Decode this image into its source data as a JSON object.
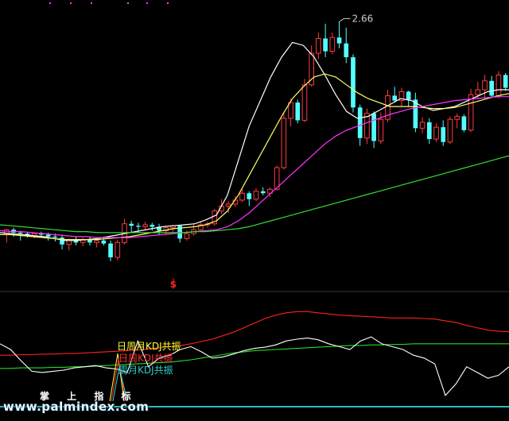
{
  "colors": {
    "background": "#000000",
    "candle_up": "#ff3c3c",
    "candle_down": "#54ffff",
    "ma_short": "#ffffff",
    "ma_mid": "#ffff66",
    "ma_long": "#ff33ff",
    "ma_xlong": "#33dd33",
    "line_red": "#ff2020",
    "line_green": "#20dd20",
    "line_white": "#ffffff",
    "label_yellow": "#ffff33",
    "label_red": "#ff3030",
    "label_cyan": "#33cccc",
    "baseline_cyan": "#20c0c0"
  },
  "chart_data": [
    {
      "type": "candlestick",
      "annotation_high": "2.66",
      "signal_marker": "S",
      "candles": [
        {
          "o": 20,
          "h": 26,
          "l": 12,
          "c": 25
        },
        {
          "o": 25,
          "h": 27,
          "l": 18,
          "c": 22
        },
        {
          "o": 22,
          "h": 24,
          "l": 14,
          "c": 21
        },
        {
          "o": 21,
          "h": 23,
          "l": 17,
          "c": 19
        },
        {
          "o": 19,
          "h": 22,
          "l": 16,
          "c": 21
        },
        {
          "o": 21,
          "h": 23,
          "l": 18,
          "c": 20
        },
        {
          "o": 20,
          "h": 22,
          "l": 14,
          "c": 18
        },
        {
          "o": 18,
          "h": 21,
          "l": 13,
          "c": 17
        },
        {
          "o": 17,
          "h": 20,
          "l": 5,
          "c": 10
        },
        {
          "o": 10,
          "h": 16,
          "l": 4,
          "c": 15
        },
        {
          "o": 15,
          "h": 18,
          "l": 9,
          "c": 12
        },
        {
          "o": 12,
          "h": 17,
          "l": 8,
          "c": 15
        },
        {
          "o": 15,
          "h": 18,
          "l": 9,
          "c": 12
        },
        {
          "o": 12,
          "h": 16,
          "l": 7,
          "c": 14
        },
        {
          "o": 14,
          "h": 18,
          "l": 9,
          "c": 11
        },
        {
          "o": 11,
          "h": 14,
          "l": -7,
          "c": -3
        },
        {
          "o": -3,
          "h": 15,
          "l": -6,
          "c": 12
        },
        {
          "o": 12,
          "h": 36,
          "l": 10,
          "c": 31
        },
        {
          "o": 31,
          "h": 34,
          "l": 22,
          "c": 29
        },
        {
          "o": 29,
          "h": 32,
          "l": 22,
          "c": 28
        },
        {
          "o": 28,
          "h": 33,
          "l": 24,
          "c": 30
        },
        {
          "o": 30,
          "h": 32,
          "l": 24,
          "c": 28
        },
        {
          "o": 28,
          "h": 31,
          "l": 20,
          "c": 24
        },
        {
          "o": 24,
          "h": 29,
          "l": 20,
          "c": 27
        },
        {
          "o": 27,
          "h": 30,
          "l": 23,
          "c": 29
        },
        {
          "o": 29,
          "h": 30,
          "l": 12,
          "c": 16
        },
        {
          "o": 16,
          "h": 24,
          "l": 14,
          "c": 21
        },
        {
          "o": 21,
          "h": 31,
          "l": 19,
          "c": 25
        },
        {
          "o": 25,
          "h": 33,
          "l": 24,
          "c": 30
        },
        {
          "o": 30,
          "h": 33,
          "l": 27,
          "c": 31
        },
        {
          "o": 31,
          "h": 46,
          "l": 29,
          "c": 44
        },
        {
          "o": 44,
          "h": 56,
          "l": 41,
          "c": 49
        },
        {
          "o": 49,
          "h": 54,
          "l": 42,
          "c": 51
        },
        {
          "o": 51,
          "h": 59,
          "l": 48,
          "c": 55
        },
        {
          "o": 55,
          "h": 66,
          "l": 53,
          "c": 62
        },
        {
          "o": 62,
          "h": 64,
          "l": 49,
          "c": 56
        },
        {
          "o": 56,
          "h": 67,
          "l": 54,
          "c": 64
        },
        {
          "o": 64,
          "h": 68,
          "l": 60,
          "c": 62
        },
        {
          "o": 62,
          "h": 68,
          "l": 58,
          "c": 66
        },
        {
          "o": 66,
          "h": 90,
          "l": 65,
          "c": 88
        },
        {
          "o": 88,
          "h": 144,
          "l": 86,
          "c": 138
        },
        {
          "o": 138,
          "h": 158,
          "l": 130,
          "c": 154
        },
        {
          "o": 154,
          "h": 157,
          "l": 133,
          "c": 136
        },
        {
          "o": 136,
          "h": 178,
          "l": 134,
          "c": 172
        },
        {
          "o": 172,
          "h": 212,
          "l": 170,
          "c": 204
        },
        {
          "o": 204,
          "h": 225,
          "l": 198,
          "c": 219
        },
        {
          "o": 219,
          "h": 234,
          "l": 200,
          "c": 206
        },
        {
          "o": 206,
          "h": 225,
          "l": 203,
          "c": 220
        },
        {
          "o": 220,
          "h": 236,
          "l": 209,
          "c": 214
        },
        {
          "o": 214,
          "h": 230,
          "l": 194,
          "c": 200
        },
        {
          "o": 200,
          "h": 203,
          "l": 144,
          "c": 149
        },
        {
          "o": 149,
          "h": 152,
          "l": 110,
          "c": 118
        },
        {
          "o": 118,
          "h": 148,
          "l": 112,
          "c": 143
        },
        {
          "o": 143,
          "h": 145,
          "l": 108,
          "c": 115
        },
        {
          "o": 115,
          "h": 144,
          "l": 112,
          "c": 137
        },
        {
          "o": 137,
          "h": 167,
          "l": 134,
          "c": 161
        },
        {
          "o": 161,
          "h": 170,
          "l": 154,
          "c": 156
        },
        {
          "o": 156,
          "h": 169,
          "l": 150,
          "c": 165
        },
        {
          "o": 165,
          "h": 166,
          "l": 150,
          "c": 157
        },
        {
          "o": 157,
          "h": 164,
          "l": 124,
          "c": 128
        },
        {
          "o": 128,
          "h": 139,
          "l": 123,
          "c": 134
        },
        {
          "o": 134,
          "h": 138,
          "l": 112,
          "c": 117
        },
        {
          "o": 117,
          "h": 133,
          "l": 114,
          "c": 129
        },
        {
          "o": 129,
          "h": 136,
          "l": 110,
          "c": 114
        },
        {
          "o": 114,
          "h": 140,
          "l": 112,
          "c": 137
        },
        {
          "o": 137,
          "h": 143,
          "l": 128,
          "c": 140
        },
        {
          "o": 140,
          "h": 142,
          "l": 124,
          "c": 126
        },
        {
          "o": 126,
          "h": 168,
          "l": 124,
          "c": 162
        },
        {
          "o": 162,
          "h": 175,
          "l": 158,
          "c": 167
        },
        {
          "o": 167,
          "h": 182,
          "l": 158,
          "c": 176
        },
        {
          "o": 176,
          "h": 181,
          "l": 159,
          "c": 161
        },
        {
          "o": 161,
          "h": 186,
          "l": 158,
          "c": 182
        },
        {
          "o": 182,
          "h": 184,
          "l": 166,
          "c": 169
        }
      ],
      "series": [
        {
          "values": [
            22,
            21,
            20,
            19,
            18,
            16,
            14,
            14,
            15,
            16,
            18,
            20,
            22,
            24,
            26,
            28,
            29,
            30,
            31,
            35,
            40,
            60,
            95,
            130,
            155,
            180,
            200,
            215,
            212,
            200,
            182,
            162,
            145,
            138,
            140,
            146,
            152,
            158,
            156,
            150,
            146,
            148,
            150,
            155,
            160,
            165,
            167,
            167
          ]
        },
        {
          "values": [
            20,
            20,
            19,
            18,
            17,
            16,
            15,
            15,
            15,
            15,
            16,
            17,
            18,
            20,
            22,
            24,
            26,
            27,
            28,
            30,
            34,
            44,
            60,
            80,
            100,
            120,
            140,
            158,
            170,
            180,
            183,
            180,
            172,
            164,
            158,
            154,
            150,
            150,
            150,
            149,
            148,
            148,
            149,
            152,
            155,
            158,
            161,
            163
          ]
        },
        {
          "values": [
            24,
            23,
            23,
            22,
            21,
            20,
            19,
            18,
            18,
            17,
            17,
            17,
            17,
            18,
            19,
            20,
            21,
            22,
            23,
            24,
            25,
            28,
            34,
            42,
            52,
            62,
            72,
            82,
            92,
            102,
            112,
            120,
            126,
            130,
            134,
            138,
            142,
            145,
            148,
            150,
            152,
            154,
            156,
            157,
            158,
            159,
            160,
            160
          ]
        },
        {
          "values": [
            30,
            29,
            28,
            27,
            26,
            25,
            24,
            23,
            23,
            22,
            22,
            22,
            22,
            22,
            22,
            22,
            22,
            22,
            23,
            23,
            24,
            25,
            26,
            28,
            31,
            34,
            37,
            40,
            43,
            46,
            49,
            52,
            55,
            58,
            61,
            64,
            67,
            70,
            73,
            76,
            79,
            82,
            85,
            88,
            91,
            94,
            97,
            100
          ]
        }
      ],
      "ylim": [
        -20,
        250
      ]
    },
    {
      "type": "line",
      "legend": [
        "日周月KDJ共振",
        "日周KDJ共振",
        "周月KDJ共振"
      ],
      "series": [
        {
          "values": [
            60,
            60,
            61,
            61,
            62,
            62,
            63,
            63,
            64,
            65,
            66,
            67,
            68,
            69,
            71,
            73,
            75,
            77,
            80,
            84,
            88,
            94,
            100,
            108,
            116,
            124,
            130,
            134,
            136,
            136,
            134,
            132,
            130,
            129,
            128,
            127,
            126,
            125,
            125,
            125,
            124,
            123,
            120,
            117,
            112,
            108,
            104,
            102,
            101
          ]
        },
        {
          "values": [
            37,
            37,
            38,
            38,
            38,
            39,
            39,
            40,
            40,
            41,
            42,
            43,
            44,
            45,
            46,
            47,
            48,
            50,
            52,
            55,
            58,
            61,
            64,
            66,
            68,
            69,
            70,
            71,
            72,
            73,
            74,
            75,
            76,
            77,
            77,
            78,
            78,
            79,
            79,
            80,
            80,
            80,
            80,
            80,
            80,
            80,
            80,
            80,
            80
          ]
        },
        {
          "values": [
            80,
            70,
            50,
            32,
            30,
            32,
            34,
            38,
            40,
            42,
            38,
            36,
            30,
            85,
            40,
            55,
            60,
            70,
            75,
            66,
            55,
            57,
            62,
            68,
            72,
            74,
            78,
            85,
            88,
            90,
            87,
            80,
            75,
            70,
            85,
            92,
            80,
            75,
            70,
            60,
            55,
            45,
            -10,
            10,
            40,
            30,
            20,
            25,
            40
          ]
        }
      ],
      "ylim": [
        -20,
        160
      ]
    }
  ],
  "watermark": {
    "cn": "掌 上 指 标",
    "url": "www.palmindex.com"
  }
}
